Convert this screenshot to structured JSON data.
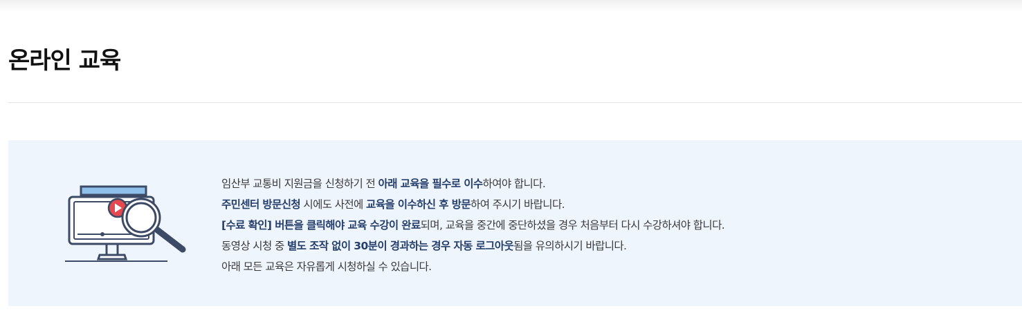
{
  "page": {
    "title": "온라인 교육"
  },
  "notice": {
    "lines": [
      {
        "t1": "임산부 교통비 지원금을 신청하기 전 ",
        "b1": "아래 교육을 필수로 이수",
        "t2": "하여야 합니다."
      },
      {
        "b1": "주민센터 방문신청",
        "t1": " 시에도 사전에 ",
        "b2": "교육을 이수하신 후 방문",
        "t2": "하여 주시기 바랍니다."
      },
      {
        "b1": "[수료 확인] 버튼을 클릭해야 교육 수강이 완료",
        "t1": "되며, 교육을 중간에 중단하셨을 경우 처음부터 다시 수강하셔야 합니다."
      },
      {
        "t1": "동영상 시청 중 ",
        "b1": "별도 조작 없이 30분이 경과하는 경우 자동 로그아웃",
        "t2": "됨을 유의하시기 바랍니다."
      },
      {
        "t1": "아래 모든 교육은 자유롭게 시청하실 수 있습니다."
      }
    ]
  },
  "colors": {
    "info_background": "#eef5fd",
    "emphasis_text": "#253e6b",
    "icon_navy": "#3c4a66",
    "icon_blue": "#8fc0ec",
    "play_red": "#e5484d"
  },
  "icons": {
    "illustration": "monitor-video-magnifier-icon"
  }
}
